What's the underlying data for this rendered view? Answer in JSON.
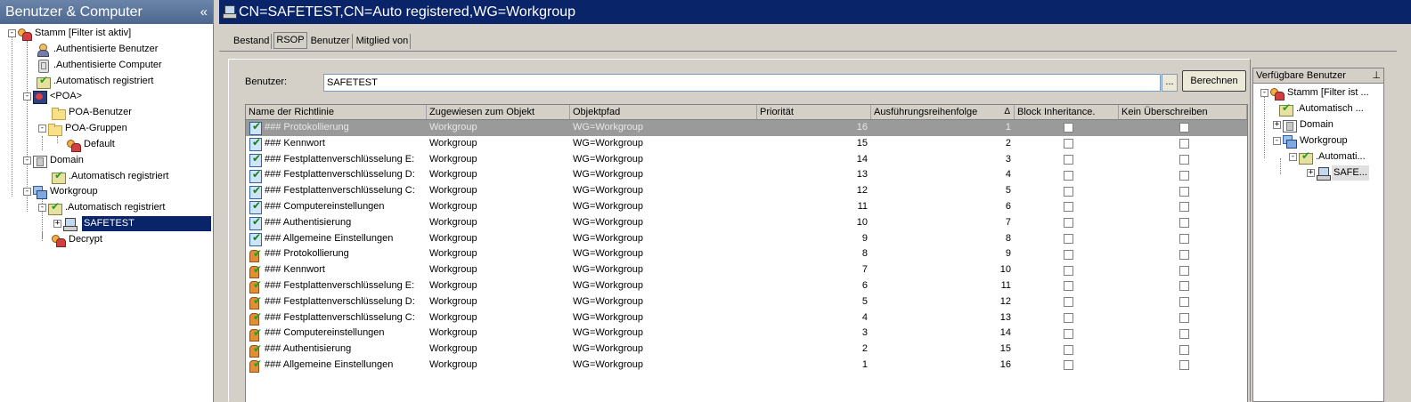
{
  "left_panel": {
    "title": "Benutzer & Computer",
    "collapse_glyph": "«",
    "tree": [
      {
        "label": "Stamm [Filter ist aktiv]",
        "icon": "users-icon",
        "expander": "-"
      },
      {
        "label": ".Authentisierte Benutzer",
        "icon": "user-icon"
      },
      {
        "label": ".Authentisierte Computer",
        "icon": "computer-icon"
      },
      {
        "label": ".Automatisch registriert",
        "icon": "check-icon"
      },
      {
        "label": "<POA>",
        "icon": "poa-icon",
        "expander": "-"
      },
      {
        "label": "POA-Benutzer",
        "icon": "folder-icon"
      },
      {
        "label": "POA-Gruppen",
        "icon": "folder-icon",
        "expander": "-"
      },
      {
        "label": "Default",
        "icon": "users-icon"
      },
      {
        "label": "Domain",
        "icon": "domain-icon",
        "expander": "-"
      },
      {
        "label": ".Automatisch registriert",
        "icon": "check-icon"
      },
      {
        "label": "Workgroup",
        "icon": "workgroup-icon",
        "expander": "-"
      },
      {
        "label": ".Automatisch registriert",
        "icon": "check-icon",
        "expander": "-"
      },
      {
        "label": "SAFETEST",
        "icon": "laptop-icon",
        "expander": "+"
      },
      {
        "label": "Decrypt",
        "icon": "users-icon"
      }
    ]
  },
  "main": {
    "title": "CN=SAFETEST,CN=Auto registered,WG=Workgroup",
    "tabs": [
      {
        "label": "Bestand"
      },
      {
        "label": "RSOP"
      },
      {
        "label": "Benutzer"
      },
      {
        "label": "Mitglied von"
      }
    ],
    "active_tab": "RSOP",
    "user_label": "Benutzer:",
    "user_value": "SAFETEST",
    "browse_label": "...",
    "calc_button": "Berechnen",
    "grid": {
      "columns": [
        "Name der Richtlinie",
        "Zugewiesen zum Objekt",
        "Objektpfad",
        "Priorität",
        "Ausführungsreihenfolge",
        "Block Inheritance.",
        "Kein Überschreiben"
      ],
      "sort_glyph": "Δ",
      "rows": [
        {
          "name": "### Protokollierung",
          "assigned": "Workgroup",
          "path": "WG=Workgroup",
          "priority": "16",
          "order": "1",
          "icon": "policy-doc-icon"
        },
        {
          "name": "### Kennwort",
          "assigned": "Workgroup",
          "path": "WG=Workgroup",
          "priority": "15",
          "order": "2",
          "icon": "policy-doc-icon"
        },
        {
          "name": "### Festplattenverschlüsselung E:",
          "assigned": "Workgroup",
          "path": "WG=Workgroup",
          "priority": "14",
          "order": "3",
          "icon": "policy-doc-icon"
        },
        {
          "name": "### Festplattenverschlüsselung D:",
          "assigned": "Workgroup",
          "path": "WG=Workgroup",
          "priority": "13",
          "order": "4",
          "icon": "policy-doc-icon"
        },
        {
          "name": "### Festplattenverschlüsselung C:",
          "assigned": "Workgroup",
          "path": "WG=Workgroup",
          "priority": "12",
          "order": "5",
          "icon": "policy-doc-icon"
        },
        {
          "name": "### Computereinstellungen",
          "assigned": "Workgroup",
          "path": "WG=Workgroup",
          "priority": "11",
          "order": "6",
          "icon": "policy-doc-icon"
        },
        {
          "name": "### Authentisierung",
          "assigned": "Workgroup",
          "path": "WG=Workgroup",
          "priority": "10",
          "order": "7",
          "icon": "policy-doc-icon"
        },
        {
          "name": "### Allgemeine Einstellungen",
          "assigned": "Workgroup",
          "path": "WG=Workgroup",
          "priority": "9",
          "order": "8",
          "icon": "policy-doc-icon"
        },
        {
          "name": "### Protokollierung",
          "assigned": "Workgroup",
          "path": "WG=Workgroup",
          "priority": "8",
          "order": "9",
          "icon": "policy-user-icon"
        },
        {
          "name": "### Kennwort",
          "assigned": "Workgroup",
          "path": "WG=Workgroup",
          "priority": "7",
          "order": "10",
          "icon": "policy-user-icon"
        },
        {
          "name": "### Festplattenverschlüsselung E:",
          "assigned": "Workgroup",
          "path": "WG=Workgroup",
          "priority": "6",
          "order": "11",
          "icon": "policy-user-icon"
        },
        {
          "name": "### Festplattenverschlüsselung D:",
          "assigned": "Workgroup",
          "path": "WG=Workgroup",
          "priority": "5",
          "order": "12",
          "icon": "policy-user-icon"
        },
        {
          "name": "### Festplattenverschlüsselung C:",
          "assigned": "Workgroup",
          "path": "WG=Workgroup",
          "priority": "4",
          "order": "13",
          "icon": "policy-user-icon"
        },
        {
          "name": "### Computereinstellungen",
          "assigned": "Workgroup",
          "path": "WG=Workgroup",
          "priority": "3",
          "order": "14",
          "icon": "policy-user-icon"
        },
        {
          "name": "### Authentisierung",
          "assigned": "Workgroup",
          "path": "WG=Workgroup",
          "priority": "2",
          "order": "15",
          "icon": "policy-user-icon"
        },
        {
          "name": "### Allgemeine Einstellungen",
          "assigned": "Workgroup",
          "path": "WG=Workgroup",
          "priority": "1",
          "order": "16",
          "icon": "policy-user-icon"
        }
      ]
    }
  },
  "available_users": {
    "title": "Verfügbare Benutzer",
    "pin_glyph": "⊥",
    "tree": [
      {
        "label": "Stamm [Filter ist ...",
        "icon": "users-icon",
        "expander": "-"
      },
      {
        "label": ".Automatisch ...",
        "icon": "check-icon"
      },
      {
        "label": "Domain",
        "icon": "domain-icon",
        "expander": "+"
      },
      {
        "label": "Workgroup",
        "icon": "workgroup-icon",
        "expander": "-"
      },
      {
        "label": ".Automati...",
        "icon": "check-icon",
        "expander": "-"
      },
      {
        "label": "SAFE...",
        "icon": "laptop-icon",
        "expander": "+"
      }
    ]
  },
  "colors": {
    "title_bar": "#0a246a",
    "selection": "#0a246a",
    "selected_row": "#9a9a9a",
    "panel_bg": "#d4d0c8"
  }
}
